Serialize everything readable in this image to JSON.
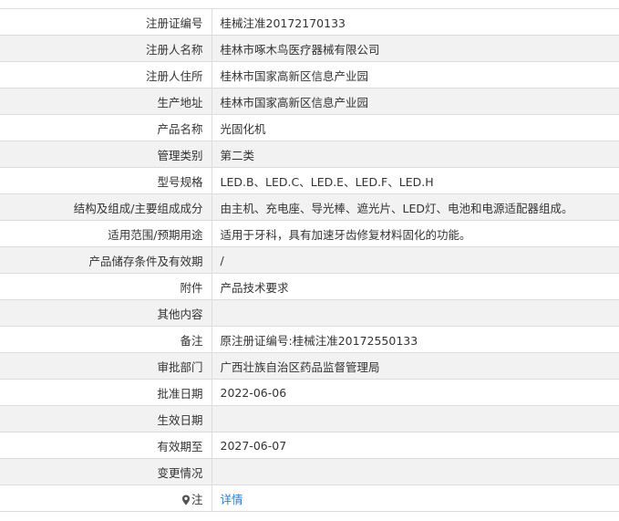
{
  "rows": [
    {
      "label": "注册证编号",
      "value": "桂械注准20172170133"
    },
    {
      "label": "注册人名称",
      "value": "桂林市啄木鸟医疗器械有限公司"
    },
    {
      "label": "注册人住所",
      "value": "桂林市国家高新区信息产业园"
    },
    {
      "label": "生产地址",
      "value": "桂林市国家高新区信息产业园"
    },
    {
      "label": "产品名称",
      "value": "光固化机"
    },
    {
      "label": "管理类别",
      "value": "第二类"
    },
    {
      "label": "型号规格",
      "value": "LED.B、LED.C、LED.E、LED.F、LED.H"
    },
    {
      "label": "结构及组成/主要组成成分",
      "value": "由主机、充电座、导光棒、遮光片、LED灯、电池和电源适配器组成。"
    },
    {
      "label": "适用范围/预期用途",
      "value": "适用于牙科，具有加速牙齿修复材料固化的功能。"
    },
    {
      "label": "产品储存条件及有效期",
      "value": "/"
    },
    {
      "label": "附件",
      "value": "产品技术要求"
    },
    {
      "label": "其他内容",
      "value": ""
    },
    {
      "label": "备注",
      "value": "原注册证编号:桂械注准20172550133"
    },
    {
      "label": "审批部门",
      "value": "广西壮族自治区药品监督管理局"
    },
    {
      "label": "批准日期",
      "value": "2022-06-06"
    },
    {
      "label": "生效日期",
      "value": ""
    },
    {
      "label": "有效期至",
      "value": "2027-06-07"
    },
    {
      "label": "变更情况",
      "value": ""
    }
  ],
  "note": {
    "icon": "map-pin-icon",
    "label": "注",
    "link_text": "详情",
    "link_color": "#2d7cc9"
  }
}
